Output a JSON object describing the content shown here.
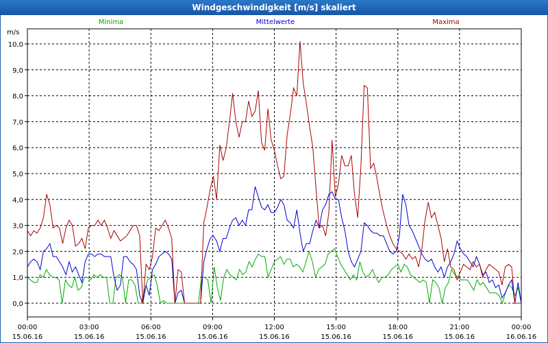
{
  "window": {
    "title": "Windgeschwindigkeit [m/s] skaliert"
  },
  "colors": {
    "minima": "#00aa00",
    "mittelwerte": "#0000cc",
    "maxima": "#aa0000",
    "title_bar": "#1f66b5"
  },
  "chart_data": {
    "type": "line",
    "title": "Windgeschwindigkeit [m/s] skaliert",
    "ylabel": "m/s",
    "xlabel": "",
    "ylim": [
      0,
      10
    ],
    "y_ticks": [
      "0,0",
      "1,0",
      "2,0",
      "3,0",
      "4,0",
      "5,0",
      "6,0",
      "7,0",
      "8,0",
      "9,0",
      "10,0"
    ],
    "x_hours": [
      0,
      3,
      6,
      9,
      12,
      15,
      18,
      21,
      24
    ],
    "x_tick_times": [
      "00:00",
      "03:00",
      "06:00",
      "09:00",
      "12:00",
      "15:00",
      "18:00",
      "21:00",
      "00:00"
    ],
    "x_tick_dates": [
      "15.06.16",
      "15.06.16",
      "15.06.16",
      "15.06.16",
      "15.06.16",
      "15.06.16",
      "15.06.16",
      "15.06.16",
      "16.06.16"
    ],
    "grid": true,
    "legend_position": "top",
    "series": [
      {
        "name": "Minima",
        "color": "#00aa00",
        "values": [
          1.0,
          0.9,
          0.8,
          0.8,
          1.1,
          1.0,
          1.3,
          1.1,
          1.0,
          1.0,
          0.9,
          0.0,
          0.9,
          0.7,
          0.6,
          1.0,
          0.5,
          0.6,
          1.0,
          1.0,
          0.9,
          1.1,
          1.0,
          1.1,
          1.0,
          1.0,
          0.0,
          0.0,
          1.0,
          1.1,
          1.0,
          0.0,
          0.9,
          0.9,
          0.7,
          0.0,
          0.0,
          0.5,
          0.9,
          1.0,
          1.1,
          0.7,
          0.0,
          0.1,
          0.0,
          0.0,
          0.0,
          0.0,
          0.0,
          0.0,
          0.0,
          0.0,
          0.0,
          0.0,
          0.0,
          1.0,
          1.0,
          0.9,
          0.0,
          1.4,
          0.6,
          0.1,
          1.0,
          1.3,
          1.1,
          1.0,
          0.9,
          1.3,
          1.1,
          1.2,
          1.6,
          1.4,
          1.7,
          1.9,
          1.8,
          1.8,
          1.0,
          1.3,
          1.6,
          1.7,
          1.8,
          1.5,
          1.7,
          1.7,
          1.4,
          1.5,
          1.4,
          1.2,
          1.6,
          2.0,
          1.6,
          1.0,
          1.3,
          1.4,
          1.5,
          1.9,
          2.0,
          2.1,
          1.8,
          1.5,
          1.3,
          1.1,
          0.9,
          1.1,
          0.9,
          1.6,
          1.2,
          1.0,
          1.1,
          1.3,
          1.0,
          0.8,
          1.0,
          1.0,
          1.1,
          1.3,
          1.4,
          1.5,
          1.2,
          1.5,
          1.4,
          1.1,
          1.0,
          0.9,
          0.8,
          0.9,
          0.8,
          0.0,
          0.9,
          0.8,
          0.6,
          0.0,
          0.6,
          0.8,
          1.3,
          1.1,
          1.0,
          0.9,
          0.9,
          0.9,
          0.7,
          0.5,
          0.9,
          0.7,
          0.8,
          0.6,
          0.4,
          0.4,
          0.4,
          0.3,
          0.0,
          0.4,
          0.7,
          0.6,
          0.3,
          0.6,
          0.0
        ]
      },
      {
        "name": "Mittelwerte",
        "color": "#0000cc",
        "values": [
          1.4,
          1.6,
          1.7,
          1.6,
          1.3,
          2.0,
          2.1,
          2.3,
          1.8,
          1.8,
          1.6,
          1.4,
          1.1,
          1.6,
          1.2,
          1.4,
          1.1,
          0.8,
          1.6,
          1.9,
          1.9,
          1.8,
          1.9,
          1.9,
          1.8,
          1.8,
          1.8,
          1.0,
          0.5,
          0.7,
          1.8,
          1.8,
          1.6,
          1.5,
          1.3,
          0.3,
          0.0,
          0.7,
          0.3,
          1.3,
          1.5,
          1.8,
          1.9,
          2.0,
          1.9,
          1.7,
          0.0,
          0.4,
          0.5,
          0.0,
          0.0,
          0.0,
          0.0,
          0.0,
          0.0,
          1.6,
          2.1,
          2.5,
          2.6,
          2.4,
          2.0,
          2.5,
          2.5,
          2.9,
          3.2,
          3.3,
          3.0,
          3.2,
          3.0,
          3.6,
          3.6,
          4.5,
          4.1,
          3.7,
          3.6,
          3.8,
          3.5,
          3.5,
          3.7,
          4.0,
          3.8,
          3.2,
          3.1,
          2.9,
          3.6,
          2.7,
          2.0,
          2.3,
          2.3,
          2.8,
          3.2,
          2.9,
          3.6,
          3.8,
          4.2,
          4.3,
          4.0,
          4.0,
          3.3,
          2.8,
          2.0,
          1.6,
          1.4,
          1.7,
          2.0,
          3.1,
          3.0,
          2.8,
          2.7,
          2.7,
          2.6,
          2.6,
          2.3,
          2.0,
          1.9,
          2.0,
          2.6,
          4.2,
          3.8,
          3.0,
          2.8,
          2.5,
          2.2,
          1.9,
          1.7,
          1.6,
          1.7,
          1.4,
          1.2,
          1.4,
          1.0,
          1.4,
          1.6,
          1.9,
          2.4,
          2.1,
          1.9,
          1.8,
          1.6,
          1.4,
          1.8,
          1.5,
          1.1,
          1.2,
          0.8,
          0.9,
          0.6,
          0.7,
          0.2,
          0.4,
          0.7,
          0.9,
          0.0,
          0.8,
          0.0
        ]
      },
      {
        "name": "Maxima",
        "color": "#aa0000",
        "values": [
          2.8,
          2.6,
          2.8,
          2.7,
          2.9,
          3.3,
          4.2,
          3.8,
          2.9,
          3.0,
          2.9,
          2.3,
          2.9,
          3.2,
          3.0,
          2.2,
          2.3,
          2.5,
          2.1,
          2.9,
          3.0,
          3.0,
          3.2,
          3.0,
          3.2,
          2.9,
          2.5,
          2.8,
          2.6,
          2.4,
          2.5,
          2.6,
          2.8,
          3.0,
          3.0,
          2.6,
          0.0,
          1.5,
          1.3,
          1.8,
          2.9,
          2.8,
          3.0,
          3.2,
          2.9,
          2.5,
          0.0,
          1.3,
          1.2,
          0.0,
          0.0,
          0.0,
          0.0,
          0.0,
          0.0,
          3.1,
          3.7,
          4.4,
          4.9,
          4.0,
          6.1,
          5.5,
          6.0,
          7.0,
          8.1,
          7.0,
          6.4,
          7.0,
          7.0,
          7.8,
          7.2,
          7.4,
          8.2,
          6.2,
          5.9,
          7.5,
          6.3,
          5.9,
          5.3,
          4.8,
          4.9,
          6.5,
          7.3,
          8.3,
          8.0,
          10.1,
          8.5,
          7.7,
          6.8,
          6.0,
          4.4,
          2.9,
          3.0,
          2.6,
          3.5,
          6.3,
          4.1,
          4.6,
          5.7,
          5.3,
          5.3,
          5.7,
          4.2,
          3.3,
          5.3,
          8.4,
          8.3,
          5.2,
          5.4,
          4.8,
          4.1,
          3.5,
          3.0,
          2.6,
          2.3,
          2.1,
          2.0,
          1.9,
          1.7,
          1.9,
          1.7,
          1.8,
          1.4,
          2.1,
          3.2,
          3.9,
          3.3,
          3.5,
          3.0,
          2.5,
          1.6,
          2.1,
          1.4,
          1.3,
          0.9,
          1.2,
          1.5,
          1.4,
          1.3,
          1.6,
          1.4,
          1.5,
          1.0,
          1.3,
          1.5,
          1.4,
          1.3,
          1.2,
          0.7,
          1.4,
          1.5,
          1.4,
          0.0,
          0.0,
          0.0
        ]
      }
    ]
  }
}
